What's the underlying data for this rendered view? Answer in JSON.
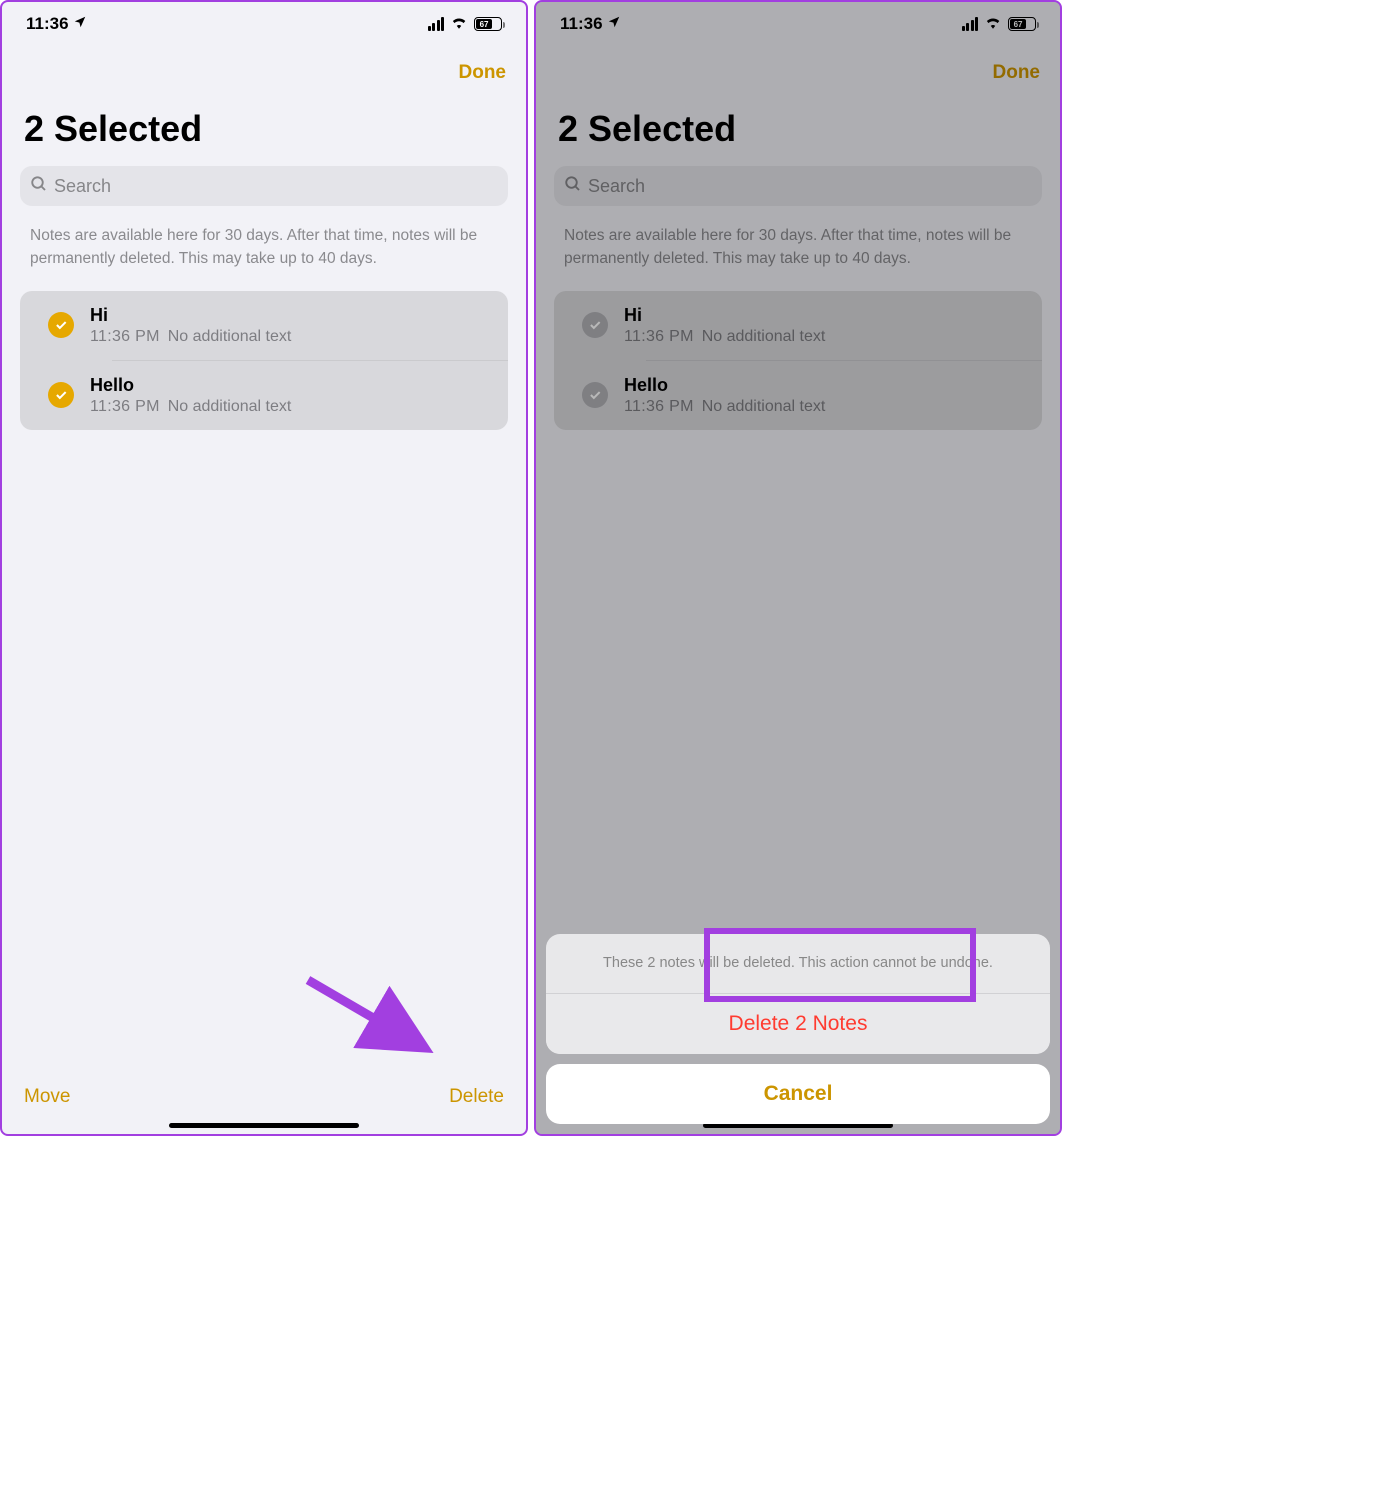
{
  "status": {
    "time": "11:36",
    "battery_pct": "67"
  },
  "nav": {
    "done": "Done"
  },
  "title": "2 Selected",
  "search": {
    "placeholder": "Search"
  },
  "info": "Notes are available here for 30 days. After that time, notes will be permanently deleted. This may take up to 40 days.",
  "notes": [
    {
      "title": "Hi",
      "time": "11:36 PM",
      "sub": "No additional text"
    },
    {
      "title": "Hello",
      "time": "11:36 PM",
      "sub": "No additional text"
    }
  ],
  "toolbar": {
    "move": "Move",
    "delete": "Delete"
  },
  "sheet": {
    "message": "These 2 notes will be deleted. This action cannot be undone.",
    "delete": "Delete 2 Notes",
    "cancel": "Cancel"
  }
}
